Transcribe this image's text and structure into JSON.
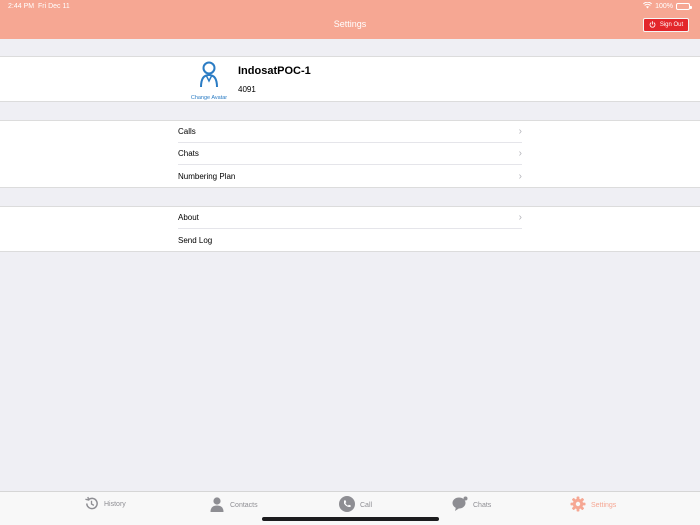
{
  "status": {
    "time": "2:44 PM",
    "date": "Fri Dec 11",
    "battery": "100%"
  },
  "nav": {
    "title": "Settings",
    "signout_label": "Sign Out"
  },
  "profile": {
    "avatar_label": "Change Avatar",
    "name": "IndosatPOC-1",
    "extension": "4091"
  },
  "section1": {
    "items": [
      {
        "label": "Calls"
      },
      {
        "label": "Chats"
      },
      {
        "label": "Numbering Plan"
      }
    ]
  },
  "section2": {
    "items": [
      {
        "label": "About"
      },
      {
        "label": "Send Log"
      }
    ]
  },
  "tabs": [
    {
      "label": "History",
      "icon": "history-icon"
    },
    {
      "label": "Contacts",
      "icon": "contacts-icon"
    },
    {
      "label": "Call",
      "icon": "phone-icon"
    },
    {
      "label": "Chats",
      "icon": "chat-icon"
    },
    {
      "label": "Settings",
      "icon": "gear-icon",
      "active": true
    }
  ],
  "colors": {
    "header": "#f6a793",
    "signout": "#e3262b",
    "avatar": "#2b7cc4",
    "active_tab": "#f6a793"
  }
}
